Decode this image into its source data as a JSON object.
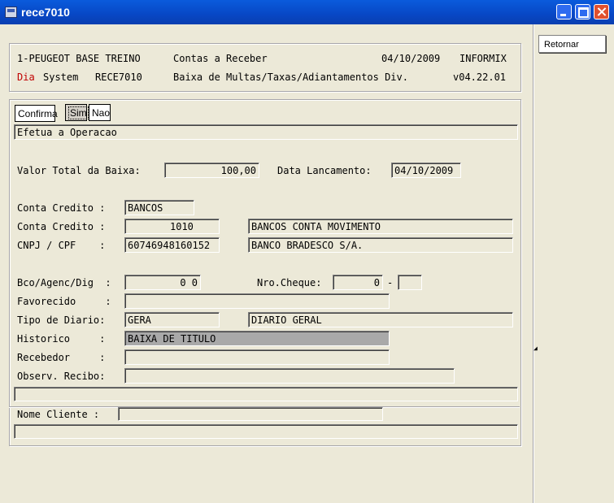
{
  "window": {
    "title": "rece7010"
  },
  "side": {
    "retornar": "Retornar"
  },
  "header": {
    "company": "1-PEUGEOT BASE TREINO",
    "module": "Contas a Receber",
    "date": "04/10/2009",
    "db": "INFORMIX",
    "day": "Dia",
    "system": "System",
    "program": "RECE7010",
    "description": "Baixa de Multas/Taxas/Adiantamentos Div.",
    "version": "v04.22.01"
  },
  "prompt": {
    "label": "Confirma",
    "yes": "Sim",
    "no": "Nao",
    "message": "Efetua a Operacao"
  },
  "form": {
    "valor_label": "Valor Total da Baixa:",
    "valor": "100,00",
    "data_label": "Data Lancamento:",
    "data": "04/10/2009",
    "conta1_label": "Conta Credito :",
    "conta1": "BANCOS",
    "conta2_label": "Conta Credito :",
    "conta2_code": "1010",
    "conta2_desc": "BANCOS CONTA MOVIMENTO",
    "cnpj_label": "CNPJ / CPF    :",
    "cnpj": "60746948160152",
    "cnpj_name": "BANCO BRADESCO S/A.",
    "bco_label": "Bco/Agenc/Dig  :",
    "bco": "0 0",
    "cheque_label": "Nro.Cheque:",
    "cheque": "0",
    "cheque_sep": "-",
    "cheque_dig": "",
    "favorecido_label": "Favorecido     :",
    "favorecido": "",
    "diario_label": "Tipo de Diario:",
    "diario_code": "GERA",
    "diario_desc": "DIARIO GERAL",
    "historico_label": "Historico     :",
    "historico": "BAIXA DE TITULO",
    "recebedor_label": "Recebedor     :",
    "recebedor": "",
    "observ_label": "Observ. Recibo:",
    "observ": ""
  },
  "footer": {
    "cliente_label": "Nome Cliente :",
    "cliente": "",
    "status": ""
  }
}
